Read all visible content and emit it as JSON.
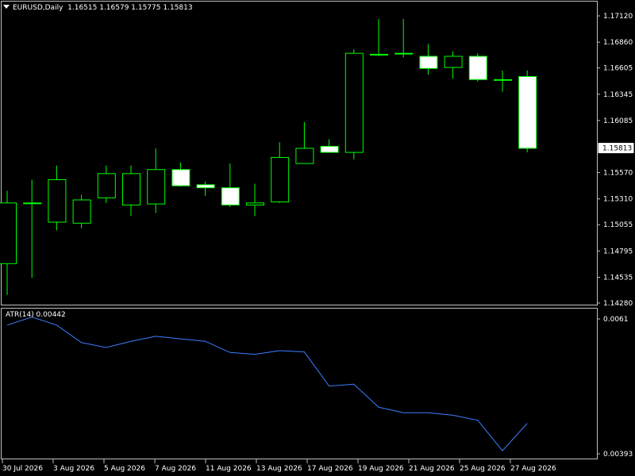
{
  "header": {
    "symbol": "EURUSD,Daily",
    "ohlc": "1.16515 1.16579 1.15775 1.15813",
    "atr_label": "ATR(14) 0.00442"
  },
  "colors": {
    "background": "#000000",
    "candle_outline": "#00ff00",
    "bull_body": "#000000",
    "bear_body": "#ffffff",
    "atr_line": "#3a7fff",
    "panel_frame": "#c0c0c0",
    "text": "#ffffff"
  },
  "current_price_label": "1.15813",
  "price_axis": {
    "min": 1.1428,
    "max": 1.1712,
    "ticks": [
      "1.17120",
      "1.16860",
      "1.16605",
      "1.16345",
      "1.16085",
      "1.15570",
      "1.15310",
      "1.15055",
      "1.14795",
      "1.14535",
      "1.14280"
    ]
  },
  "atr_axis": {
    "ticks": [
      "0.0061",
      "0.00393"
    ]
  },
  "x_axis": {
    "labels": [
      "30 Jul 2026",
      "3 Aug 2026",
      "5 Aug 2026",
      "7 Aug 2026",
      "11 Aug 2026",
      "13 Aug 2026",
      "17 Aug 2026",
      "19 Aug 2026",
      "21 Aug 2026",
      "25 Aug 2026",
      "27 Aug 2026"
    ]
  },
  "chart_data": {
    "type": "candlestick",
    "symbol": "EURUSD",
    "timeframe": "Daily",
    "candles": [
      {
        "open": 1.1467,
        "high": 1.1539,
        "low": 1.1436,
        "close": 1.1527
      },
      {
        "open": 1.1527,
        "high": 1.155,
        "low": 1.1453,
        "close": 1.1527
      },
      {
        "open": 1.1508,
        "high": 1.1564,
        "low": 1.15,
        "close": 1.155
      },
      {
        "open": 1.1507,
        "high": 1.1535,
        "low": 1.1502,
        "close": 1.153
      },
      {
        "open": 1.1532,
        "high": 1.1564,
        "low": 1.1527,
        "close": 1.1556
      },
      {
        "open": 1.1525,
        "high": 1.1564,
        "low": 1.1514,
        "close": 1.1556
      },
      {
        "open": 1.1526,
        "high": 1.1581,
        "low": 1.1517,
        "close": 1.156
      },
      {
        "open": 1.156,
        "high": 1.1567,
        "low": 1.1543,
        "close": 1.1544
      },
      {
        "open": 1.1545,
        "high": 1.1548,
        "low": 1.1534,
        "close": 1.1542
      },
      {
        "open": 1.1542,
        "high": 1.1566,
        "low": 1.1523,
        "close": 1.1525
      },
      {
        "open": 1.1525,
        "high": 1.1546,
        "low": 1.1514,
        "close": 1.1527
      },
      {
        "open": 1.1528,
        "high": 1.1587,
        "low": 1.1527,
        "close": 1.1572
      },
      {
        "open": 1.1566,
        "high": 1.1607,
        "low": 1.1566,
        "close": 1.1581
      },
      {
        "open": 1.1583,
        "high": 1.159,
        "low": 1.1577,
        "close": 1.1577
      },
      {
        "open": 1.1577,
        "high": 1.1679,
        "low": 1.157,
        "close": 1.1675
      },
      {
        "open": 1.1674,
        "high": 1.1709,
        "low": 1.1672,
        "close": 1.1674
      },
      {
        "open": 1.1675,
        "high": 1.1709,
        "low": 1.1671,
        "close": 1.1675
      },
      {
        "open": 1.1672,
        "high": 1.1684,
        "low": 1.1654,
        "close": 1.166
      },
      {
        "open": 1.1661,
        "high": 1.1677,
        "low": 1.165,
        "close": 1.1672
      },
      {
        "open": 1.1672,
        "high": 1.1675,
        "low": 1.1647,
        "close": 1.1649
      },
      {
        "open": 1.1649,
        "high": 1.1658,
        "low": 1.1637,
        "close": 1.1649
      },
      {
        "open": 1.1652,
        "high": 1.1658,
        "low": 1.1577,
        "close": 1.1581
      }
    ],
    "atr": {
      "name": "ATR(14)",
      "period": 14,
      "last": 0.00442,
      "values": [
        0.006,
        0.00613,
        0.006,
        0.00572,
        0.00564,
        0.00574,
        0.00582,
        0.00578,
        0.00574,
        0.00556,
        0.00553,
        0.00559,
        0.00557,
        0.00502,
        0.00505,
        0.00468,
        0.00459,
        0.00459,
        0.00455,
        0.00447,
        0.00398,
        0.00442
      ]
    }
  }
}
